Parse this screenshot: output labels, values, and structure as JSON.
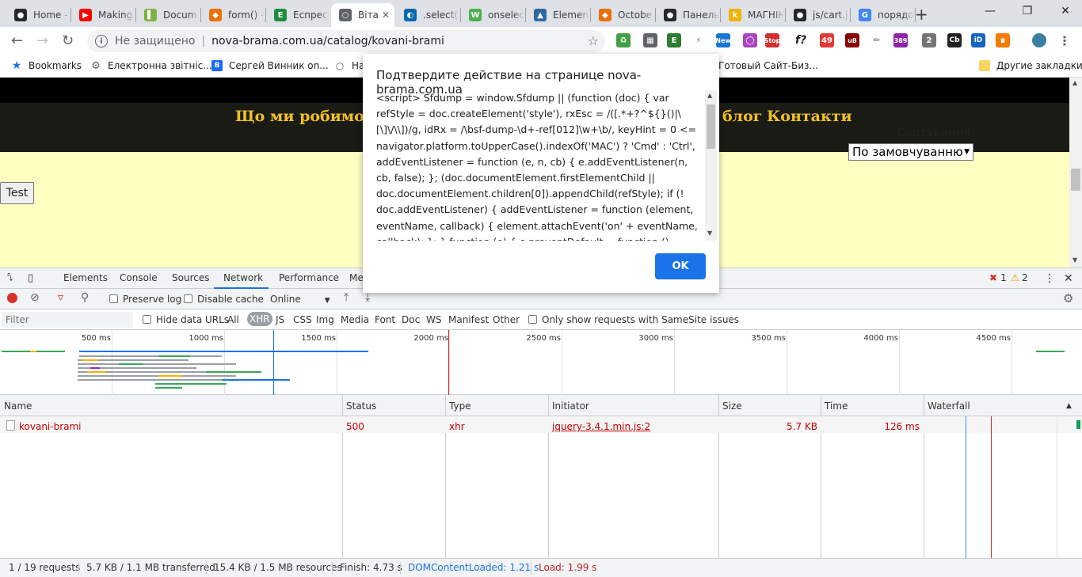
{
  "tabs": [
    {
      "title": "Home -",
      "icon": "github-icon",
      "color": "#24292e"
    },
    {
      "title": "Making",
      "icon": "youtube-icon",
      "color": "#ff0000"
    },
    {
      "title": "Docum",
      "icon": "docs-icon",
      "color": "#7cb342"
    },
    {
      "title": "form() -",
      "icon": "flame-icon",
      "color": "#e8710a"
    },
    {
      "title": "Еспресс",
      "icon": "espresso-icon",
      "color": "#1e8e3e"
    },
    {
      "title": "Віта",
      "icon": "globe-icon",
      "color": "#5f6368"
    },
    {
      "title": ".select()",
      "icon": "jquery-icon",
      "color": "#0769ad"
    },
    {
      "title": "onselec",
      "icon": "w3-icon",
      "color": "#4caf50"
    },
    {
      "title": "Element",
      "icon": "element-icon",
      "color": "#2d6a9f"
    },
    {
      "title": "Octobe",
      "icon": "flame-icon",
      "color": "#e8710a"
    },
    {
      "title": "Панель",
      "icon": "github-icon",
      "color": "#24292e"
    },
    {
      "title": "МАГНІК",
      "icon": "k-icon",
      "color": "#f2b300"
    },
    {
      "title": "js/cart.j",
      "icon": "github-icon",
      "color": "#24292e"
    },
    {
      "title": "порядо",
      "icon": "google-icon",
      "color": "#4285f4"
    }
  ],
  "omnibox": {
    "security": "Не защищено",
    "url": "nova-brama.com.ua/catalog/kovani-brami"
  },
  "extensions": {
    "badge_new": "New",
    "badge_stop": "Stop",
    "badge_fx": "f?",
    "badge_mail": "49",
    "badge_ub": "uB",
    "badge_389": "389",
    "badge_2": "2",
    "badge_cb": "Cb",
    "badge_id": "iD"
  },
  "bookmarks": [
    {
      "label": "Bookmarks",
      "icon": "star-icon",
      "color": "#1a73e8"
    },
    {
      "label": "Електронна звітніс...",
      "icon": "gear-icon",
      "color": "#5f6368"
    },
    {
      "label": "Сергей Винник on...",
      "icon": "behance-icon",
      "color": "#1769ff"
    },
    {
      "label": "На",
      "icon": "globe-icon",
      "color": "#5f6368"
    },
    {
      "label": "Готовый Сайт-Биз...",
      "icon": "none",
      "color": "#ffffff"
    },
    {
      "label": "Другие закладки",
      "icon": "folder-icon",
      "color": "#f9d564"
    }
  ],
  "page": {
    "nav_left": "Що ми робимо?",
    "nav_blog": "блог",
    "nav_contacts": "Контакти",
    "sort_label": "Сортування:",
    "sort_value": "По замовчуванню",
    "test_button": "Test",
    "bg_color": "#ffffc2",
    "nav_color": "#f0c21f"
  },
  "dialog": {
    "title": "Подтвердите действие на странице nova-brama.com.ua",
    "body": "<script> Sfdump = window.Sfdump || (function (doc) { var refStyle = doc.createElement('style'), rxEsc = /([.*+?^${}()|\\[\\]\\/\\\\])/g, idRx = /\\bsf-dump-\\d+-ref[012]\\w+\\b/, keyHint = 0 <= navigator.platform.toUpperCase().indexOf('MAC') ? 'Cmd' : 'Ctrl', addEventListener = function (e, n, cb) { e.addEventListener(n, cb, false); }; (doc.documentElement.firstElementChild || doc.documentElement.children[0]).appendChild(refStyle); if (! doc.addEventListener) { addEventListener = function (element, eventName, callback) { element.attachEvent('on' + eventName, callback); }; } function (e) { e.preventDefault = function () {e.returnValue = false;};",
    "ok": "OK"
  },
  "devtools": {
    "tabs": [
      "Elements",
      "Console",
      "Sources",
      "Network",
      "Performance",
      "Me"
    ],
    "selected_tab": "Network",
    "errors": "1",
    "warnings": "2",
    "preserve_log": "Preserve log",
    "disable_cache": "Disable cache",
    "throttle": "Online",
    "filter_placeholder": "Filter",
    "hide_data_urls": "Hide data URLs",
    "type_filters": [
      "All",
      "XHR",
      "JS",
      "CSS",
      "Img",
      "Media",
      "Font",
      "Doc",
      "WS",
      "Manifest",
      "Other"
    ],
    "selected_type": "XHR",
    "samesite": "Only show requests with SameSite issues",
    "timeline_ticks": [
      "500 ms",
      "1000 ms",
      "1500 ms",
      "2000 ms",
      "2500 ms",
      "3000 ms",
      "3500 ms",
      "4000 ms",
      "4500 ms"
    ],
    "columns": [
      "Name",
      "Status",
      "Type",
      "Initiator",
      "Size",
      "Time",
      "Waterfall"
    ],
    "rows": [
      {
        "name": "kovani-brami",
        "status": "500",
        "type": "xhr",
        "initiator": "jquery-3.4.1.min.js:2",
        "size": "5.7 KB",
        "time": "126 ms"
      }
    ],
    "status_bar": {
      "requests": "1 / 19 requests",
      "transferred": "5.7 KB / 1.1 MB transferred",
      "resources": "15.4 KB / 1.5 MB resources",
      "finish": "Finish: 4.73 s",
      "dcl": "DOMContentLoaded: 1.21 s",
      "load": "Load: 1.99 s"
    }
  }
}
